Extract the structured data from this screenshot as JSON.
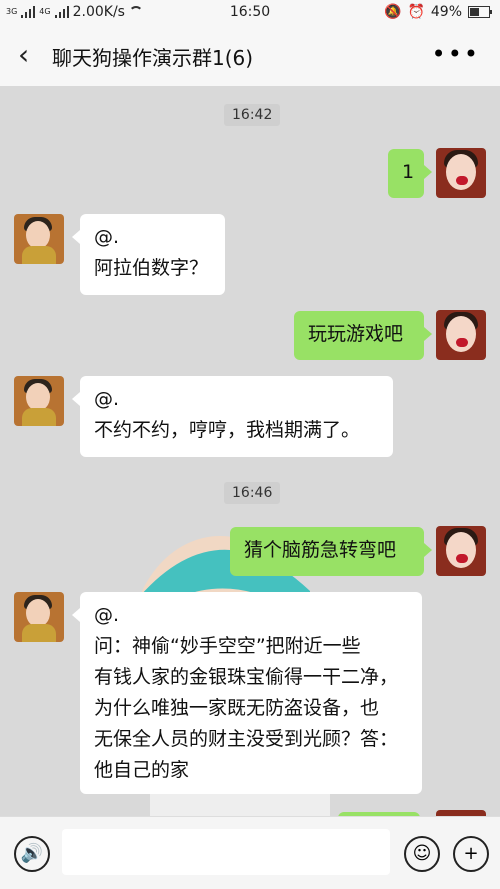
{
  "status_bar": {
    "network_small": "3G",
    "network_small2": "4G",
    "speed": "2.00K/s",
    "time": "16:50",
    "battery": "49%",
    "battery_level": 0.49
  },
  "topbar": {
    "title": "聊天狗操作演示群1(6)",
    "back_icon": "‹",
    "more_icon": "•••"
  },
  "chat": {
    "timestamps": [
      "16:42",
      "16:46"
    ],
    "messages": [
      {
        "from": "me",
        "lines": [
          "1"
        ]
      },
      {
        "from": "them",
        "lines": [
          "@.",
          "阿拉伯数字？"
        ]
      },
      {
        "from": "me",
        "lines": [
          "玩玩游戏吧"
        ]
      },
      {
        "from": "them",
        "lines": [
          "@.",
          "不约不约，哼哼，我档期满了。"
        ]
      },
      {
        "from": "me",
        "lines": [
          "猜个脑筋急转弯吧"
        ]
      },
      {
        "from": "them",
        "lines": [
          "@.",
          "问：神偷“妙手空空”把附近一些",
          "有钱人家的金银珠宝偷得一干二净，",
          "为什么唯独一家既无防盗设备，也",
          "无保全人员的财主没受到光顾？答：",
          "他自己的家"
        ]
      }
    ]
  },
  "inputbar": {
    "voice_icon": "🔊",
    "emoji_icon": "☺",
    "plus_icon": "+"
  }
}
